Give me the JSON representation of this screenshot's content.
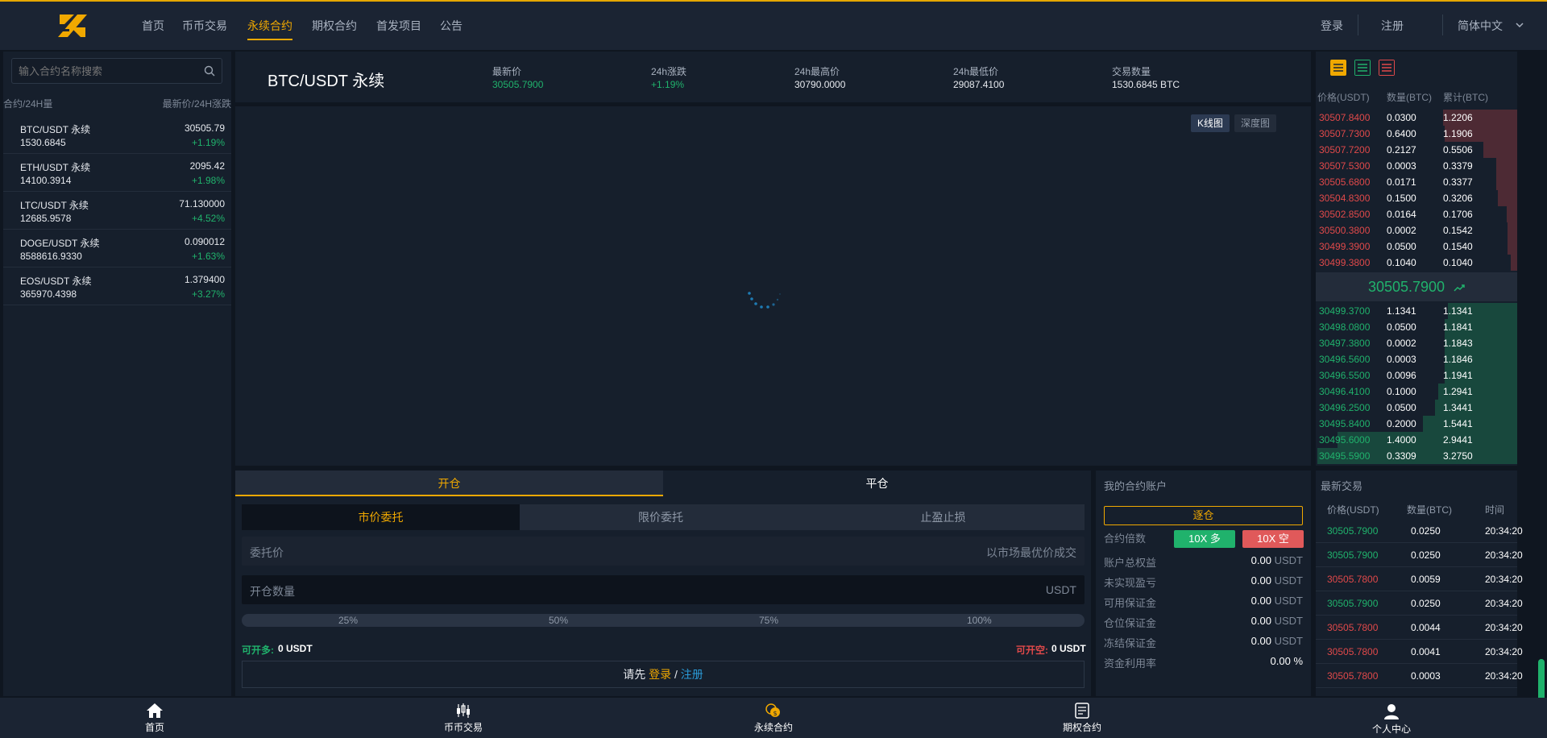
{
  "nav": {
    "items": [
      "首页",
      "币币交易",
      "永续合约",
      "期权合约",
      "首发项目",
      "公告"
    ],
    "active_index": 2,
    "login": "登录",
    "register": "注册",
    "language": "简体中文"
  },
  "markets": {
    "search_placeholder": "输入合约名称搜索",
    "col_left": "合约/24H量",
    "col_right": "最新价/24H涨跌",
    "rows": [
      {
        "name": "BTC/USDT 永续",
        "volume": "1530.6845",
        "price": "30505.79",
        "change": "+1.19%"
      },
      {
        "name": "ETH/USDT 永续",
        "volume": "14100.3914",
        "price": "2095.42",
        "change": "+1.98%"
      },
      {
        "name": "LTC/USDT 永续",
        "volume": "12685.9578",
        "price": "71.130000",
        "change": "+4.52%"
      },
      {
        "name": "DOGE/USDT 永续",
        "volume": "8588616.9330",
        "price": "0.090012",
        "change": "+1.63%"
      },
      {
        "name": "EOS/USDT 永续",
        "volume": "365970.4398",
        "price": "1.379400",
        "change": "+3.27%"
      }
    ]
  },
  "ticker": {
    "pair": "BTC/USDT 永续",
    "last_label": "最新价",
    "last": "30505.7900",
    "change_label": "24h涨跌",
    "change": "+1.19%",
    "high_label": "24h最高价",
    "high": "30790.0000",
    "low_label": "24h最低价",
    "low": "29087.4100",
    "volume_label": "交易数量",
    "volume": "1530.6845 BTC"
  },
  "chart": {
    "tab_kline": "K线图",
    "tab_depth": "深度图"
  },
  "order_form": {
    "tab_open": "开仓",
    "tab_close": "平仓",
    "type_market": "市价委托",
    "type_limit": "限价委托",
    "type_tpsl": "止盈止损",
    "price_label": "委托价",
    "price_hint": "以市场最优价成交",
    "qty_label": "开仓数量",
    "qty_unit": "USDT",
    "pcts": [
      "25%",
      "50%",
      "75%",
      "100%"
    ],
    "long_label": "可开多:",
    "long_value": "0 USDT",
    "short_label": "可开空:",
    "short_value": "0 USDT",
    "login_prefix": "请先",
    "login_link": "登录",
    "login_sep": " / ",
    "register_link": "注册"
  },
  "account": {
    "title": "我的合约账户",
    "mode_button": "逐仓",
    "leverage_label": "合约倍数",
    "long_btn": "10X 多",
    "short_btn": "10X 空",
    "rows": [
      {
        "label": "账户总权益",
        "value": "0.00",
        "unit": "USDT"
      },
      {
        "label": "未实现盈亏",
        "value": "0.00",
        "unit": "USDT"
      },
      {
        "label": "可用保证金",
        "value": "0.00",
        "unit": "USDT"
      },
      {
        "label": "仓位保证金",
        "value": "0.00",
        "unit": "USDT"
      },
      {
        "label": "冻结保证金",
        "value": "0.00",
        "unit": "USDT"
      },
      {
        "label": "资金利用率",
        "value": "0.00",
        "unit": "%"
      }
    ]
  },
  "orderbook": {
    "col_price": "价格(USDT)",
    "col_qty": "数量(BTC)",
    "col_cum": "累计(BTC)",
    "mid_price": "30505.7900",
    "asks": [
      {
        "price": "30507.8400",
        "qty": "0.0300",
        "cum": "1.2206"
      },
      {
        "price": "30507.7300",
        "qty": "0.6400",
        "cum": "1.1906"
      },
      {
        "price": "30507.7200",
        "qty": "0.2127",
        "cum": "0.5506"
      },
      {
        "price": "30507.5300",
        "qty": "0.0003",
        "cum": "0.3379"
      },
      {
        "price": "30505.6800",
        "qty": "0.0171",
        "cum": "0.3377"
      },
      {
        "price": "30504.8300",
        "qty": "0.1500",
        "cum": "0.3206"
      },
      {
        "price": "30502.8500",
        "qty": "0.0164",
        "cum": "0.1706"
      },
      {
        "price": "30500.3800",
        "qty": "0.0002",
        "cum": "0.1542"
      },
      {
        "price": "30499.3900",
        "qty": "0.0500",
        "cum": "0.1540"
      },
      {
        "price": "30499.3800",
        "qty": "0.1040",
        "cum": "0.1040"
      }
    ],
    "bids": [
      {
        "price": "30499.3700",
        "qty": "1.1341",
        "cum": "1.1341"
      },
      {
        "price": "30498.0800",
        "qty": "0.0500",
        "cum": "1.1841"
      },
      {
        "price": "30497.3800",
        "qty": "0.0002",
        "cum": "1.1843"
      },
      {
        "price": "30496.5600",
        "qty": "0.0003",
        "cum": "1.1846"
      },
      {
        "price": "30496.5500",
        "qty": "0.0096",
        "cum": "1.1941"
      },
      {
        "price": "30496.4100",
        "qty": "0.1000",
        "cum": "1.2941"
      },
      {
        "price": "30496.2500",
        "qty": "0.0500",
        "cum": "1.3441"
      },
      {
        "price": "30495.8400",
        "qty": "0.2000",
        "cum": "1.5441"
      },
      {
        "price": "30495.6000",
        "qty": "1.4000",
        "cum": "2.9441"
      },
      {
        "price": "30495.5900",
        "qty": "0.3309",
        "cum": "3.2750"
      }
    ]
  },
  "trades": {
    "title": "最新交易",
    "col_price": "价格(USDT)",
    "col_qty": "数量(BTC)",
    "col_time": "时间",
    "rows": [
      {
        "price": "30505.7900",
        "qty": "0.0250",
        "time": "20:34:20",
        "side": "buy"
      },
      {
        "price": "30505.7900",
        "qty": "0.0250",
        "time": "20:34:20",
        "side": "buy"
      },
      {
        "price": "30505.7800",
        "qty": "0.0059",
        "time": "20:34:20",
        "side": "sell"
      },
      {
        "price": "30505.7900",
        "qty": "0.0250",
        "time": "20:34:20",
        "side": "buy"
      },
      {
        "price": "30505.7800",
        "qty": "0.0044",
        "time": "20:34:20",
        "side": "sell"
      },
      {
        "price": "30505.7800",
        "qty": "0.0041",
        "time": "20:34:20",
        "side": "sell"
      },
      {
        "price": "30505.7800",
        "qty": "0.0003",
        "time": "20:34:20",
        "side": "sell"
      }
    ]
  },
  "bottom_nav": [
    "首页",
    "币币交易",
    "永续合约",
    "期权合约",
    "个人中心"
  ],
  "colors": {
    "accent": "#f0a800",
    "up": "#20b26c",
    "down": "#e0494a",
    "link": "#2a9bd8"
  }
}
